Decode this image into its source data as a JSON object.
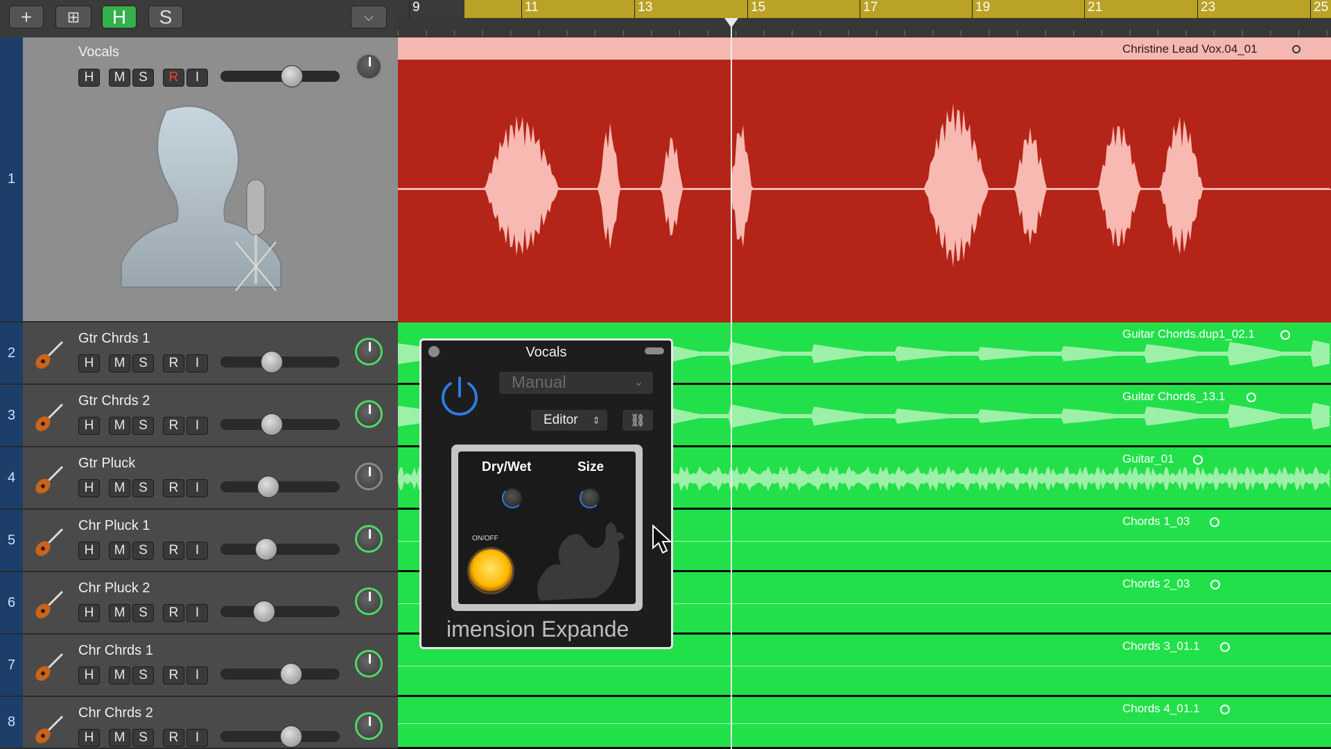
{
  "toolbar": {
    "add_label": "+",
    "add_folder_label": "⊞",
    "header_h_label": "H",
    "header_s_label": "S",
    "collapse_label": "⌵"
  },
  "ruler": {
    "bars": [
      "9",
      "11",
      "13",
      "15",
      "17",
      "19",
      "21",
      "23",
      "25"
    ]
  },
  "tracks": [
    {
      "number": "1",
      "name": "Vocals",
      "h": "H",
      "m": "M",
      "s": "S",
      "r": "R",
      "i": "I"
    },
    {
      "number": "2",
      "name": "Gtr Chrds 1",
      "h": "H",
      "m": "M",
      "s": "S",
      "r": "R",
      "i": "I"
    },
    {
      "number": "3",
      "name": "Gtr Chrds 2",
      "h": "H",
      "m": "M",
      "s": "S",
      "r": "R",
      "i": "I"
    },
    {
      "number": "4",
      "name": "Gtr Pluck",
      "h": "H",
      "m": "M",
      "s": "S",
      "r": "R",
      "i": "I"
    },
    {
      "number": "5",
      "name": "Chr Pluck 1",
      "h": "H",
      "m": "M",
      "s": "S",
      "r": "R",
      "i": "I"
    },
    {
      "number": "6",
      "name": "Chr Pluck 2",
      "h": "H",
      "m": "M",
      "s": "S",
      "r": "R",
      "i": "I"
    },
    {
      "number": "7",
      "name": "Chr Chrds 1",
      "h": "H",
      "m": "M",
      "s": "S",
      "r": "R",
      "i": "I"
    },
    {
      "number": "8",
      "name": "Chr Chrds 2",
      "h": "H",
      "m": "M",
      "s": "S",
      "r": "R",
      "i": "I"
    }
  ],
  "regions": [
    "Christine Lead Vox.04_01",
    "Guitar Chords.dup1_02.1",
    "Guitar Chords_13.1",
    "Guitar_01",
    "Chords 1_03",
    "Chords 2_03",
    "Chords 3_01.1",
    "Chords 4_01.1"
  ],
  "plugin": {
    "title": "Vocals",
    "preset": "Manual",
    "editor": "Editor",
    "link": "⛓",
    "drywet_label": "Dry/Wet",
    "size_label": "Size",
    "onoff_label": "ON/OFF",
    "name": "imension Expande"
  },
  "colors": {
    "vocal_region": "#b52418",
    "vocal_region_header": "#f5b8b0",
    "green_region": "#22e04a",
    "selected_track": "#8e8e8e",
    "cycle_bar": "#b9a226"
  }
}
